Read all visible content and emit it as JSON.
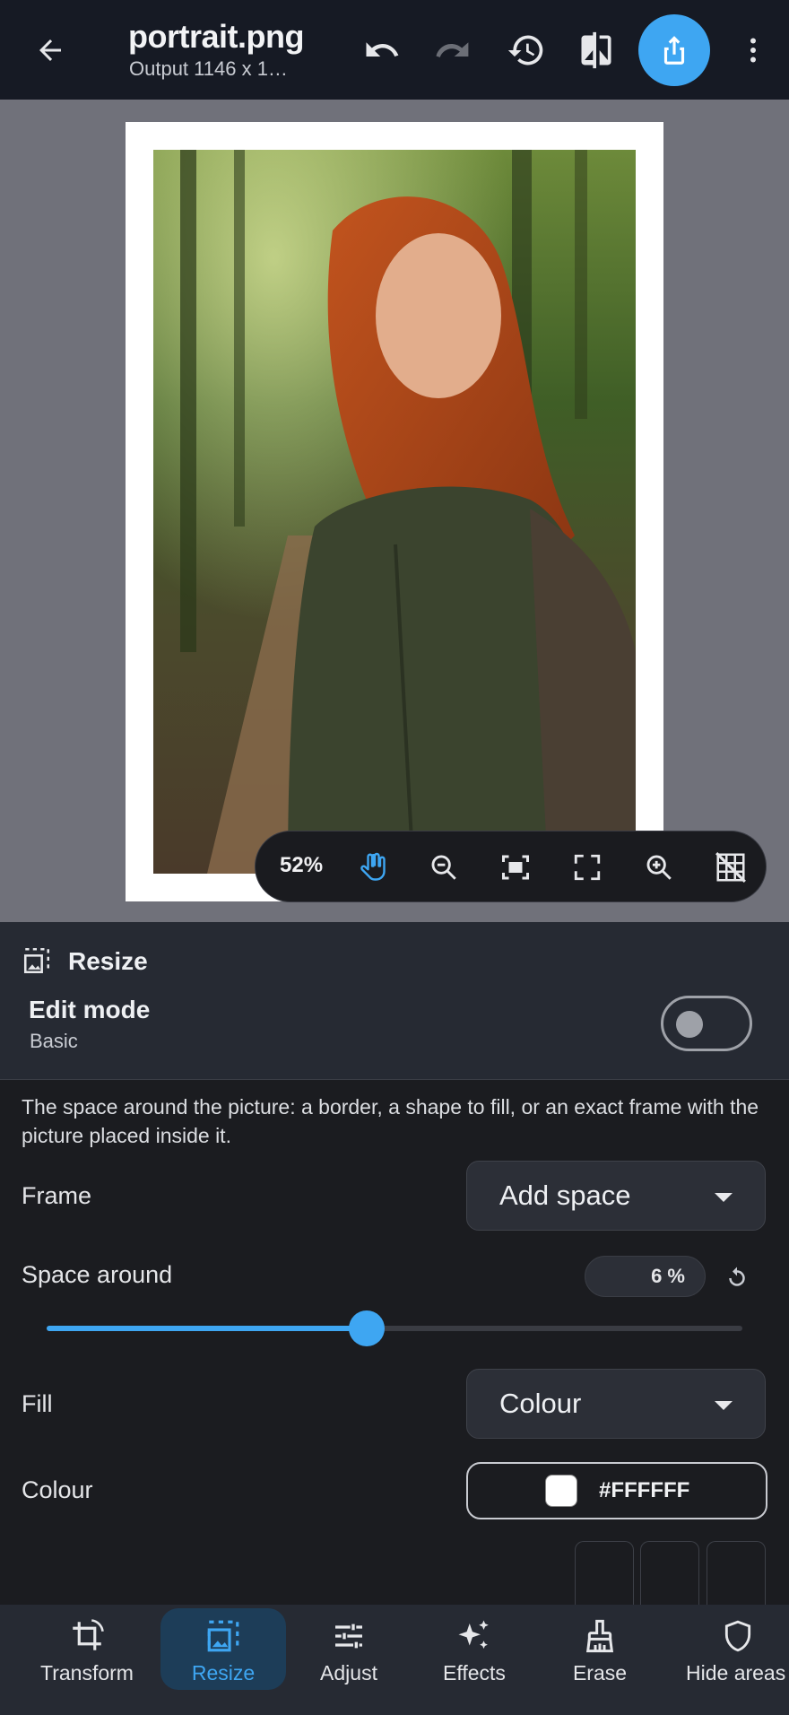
{
  "header": {
    "title": "portrait.png",
    "subtitle": "Output 1146 x 1…",
    "icons": [
      "back-arrow-icon",
      "undo-icon",
      "redo-icon",
      "history-icon",
      "compare-icon",
      "share-icon",
      "more-vert-icon"
    ],
    "accent": "#3ea6f2"
  },
  "zoom": {
    "percent": "52%",
    "icons": [
      "hand-pan-icon",
      "zoom-out-icon",
      "fit-screen-icon",
      "fullscreen-icon",
      "zoom-in-icon",
      "grid-off-icon"
    ]
  },
  "panel": {
    "section_title": "Resize",
    "edit_mode_label": "Edit mode",
    "edit_mode_value": "Basic",
    "edit_mode_toggle_on": false,
    "description": "The space around the picture: a border, a shape to fill, or an exact frame with the picture placed inside it.",
    "frame_label": "Frame",
    "frame_value": "Add space",
    "space_label": "Space around",
    "space_value": "6 %",
    "space_slider_fraction": 0.46,
    "fill_label": "Fill",
    "fill_value": "Colour",
    "colour_label": "Colour",
    "colour_value": "#FFFFFF",
    "colour_swatch": "#FFFFFF"
  },
  "nav": {
    "items": [
      {
        "label": "Transform",
        "icon": "crop-rotate-icon"
      },
      {
        "label": "Resize",
        "icon": "resize-icon"
      },
      {
        "label": "Adjust",
        "icon": "tune-icon"
      },
      {
        "label": "Effects",
        "icon": "sparkle-icon"
      },
      {
        "label": "Erase",
        "icon": "brush-icon"
      },
      {
        "label": "Hide areas",
        "icon": "shield-icon"
      }
    ],
    "active": "Resize",
    "active_color": "#3ea6f2"
  }
}
